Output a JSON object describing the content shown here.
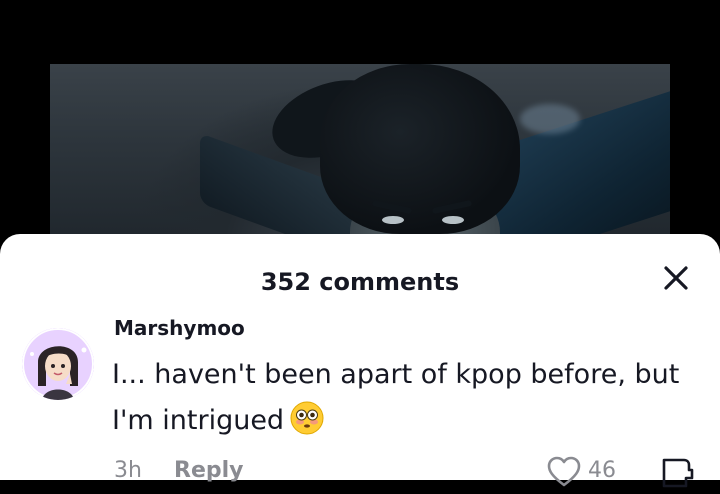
{
  "comments_sheet": {
    "title": "352 comments",
    "close_icon": "close-icon"
  },
  "comment": {
    "username": "Marshymoo",
    "text_line1": "I... haven't been apart of kpop before, but",
    "text_line2": "I'm intrigued",
    "emoji": "flushed-face-emoji",
    "time": "3h",
    "reply_label": "Reply",
    "like_count": "46",
    "like_icon": "heart-outline-icon",
    "dislike_icon": "dislike-icon"
  },
  "colors": {
    "text": "#161823",
    "muted": "#8a8b91",
    "sheet_background": "#ffffff",
    "page_background": "#000000"
  }
}
